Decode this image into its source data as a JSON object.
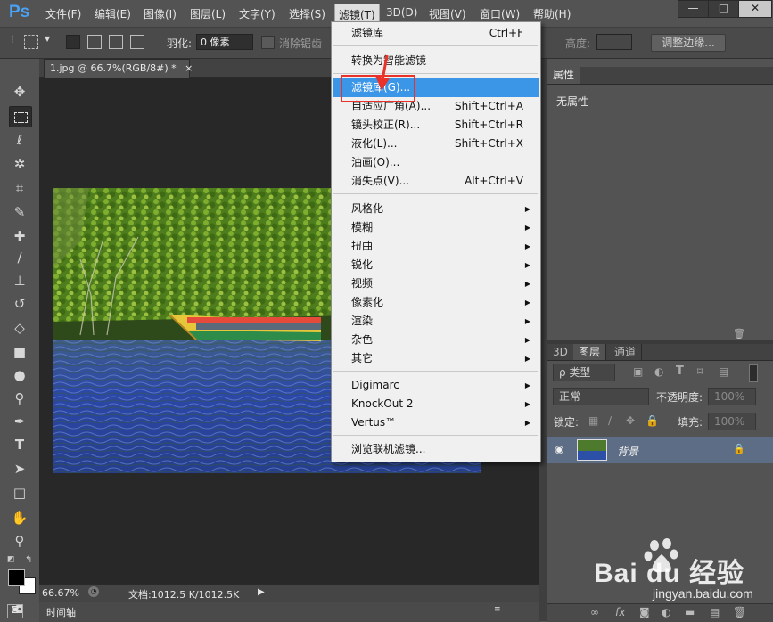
{
  "app": {
    "logo": "Ps",
    "menus": [
      "文件(F)",
      "编辑(E)",
      "图像(I)",
      "图层(L)",
      "文字(Y)",
      "选择(S)",
      "滤镜(T)",
      "3D(D)",
      "视图(V)",
      "窗口(W)",
      "帮助(H)"
    ],
    "active_menu": "滤镜(T)",
    "window_buttons": [
      "—",
      "□",
      "✕"
    ]
  },
  "options_bar": {
    "feather_label": "羽化:",
    "feather_value": "0 像素",
    "antialias_label": "消除锯齿",
    "height_label": "高度:",
    "refine_edge_button": "调整边缘..."
  },
  "document": {
    "tab_title": "1.jpg @ 66.7%(RGB/8#) *",
    "tab_close": "×",
    "zoom": "66.67%",
    "doc_info": "文档:1012.5 K/1012.5K",
    "timeline_label": "时间轴"
  },
  "properties_panel": {
    "tab": "属性",
    "content": "无属性"
  },
  "layers_panel": {
    "tabs": [
      "3D",
      "图层",
      "通道"
    ],
    "active_tab": "图层",
    "filter_label": "ρ 类型",
    "blend_mode": "正常",
    "opacity_label": "不透明度:",
    "opacity_value": "100%",
    "lock_label": "锁定:",
    "fill_label": "填充:",
    "fill_value": "100%",
    "layer_name": "背景"
  },
  "filter_menu": {
    "items": [
      {
        "label": "滤镜库",
        "shortcut": "Ctrl+F"
      },
      {
        "label": "转换为智能滤镜",
        "shortcut": ""
      },
      {
        "label": "滤镜库(G)...",
        "shortcut": "",
        "highlighted": true
      },
      {
        "label": "自适应广角(A)...",
        "shortcut": "Shift+Ctrl+A"
      },
      {
        "label": "镜头校正(R)...",
        "shortcut": "Shift+Ctrl+R"
      },
      {
        "label": "液化(L)...",
        "shortcut": "Shift+Ctrl+X"
      },
      {
        "label": "油画(O)...",
        "shortcut": ""
      },
      {
        "label": "消失点(V)...",
        "shortcut": "Alt+Ctrl+V"
      },
      {
        "label": "风格化",
        "submenu": true
      },
      {
        "label": "模糊",
        "submenu": true
      },
      {
        "label": "扭曲",
        "submenu": true
      },
      {
        "label": "锐化",
        "submenu": true
      },
      {
        "label": "视频",
        "submenu": true
      },
      {
        "label": "像素化",
        "submenu": true
      },
      {
        "label": "渲染",
        "submenu": true
      },
      {
        "label": "杂色",
        "submenu": true
      },
      {
        "label": "其它",
        "submenu": true
      },
      {
        "label": "Digimarc",
        "submenu": true
      },
      {
        "label": "KnockOut 2",
        "submenu": true
      },
      {
        "label": "Vertus™",
        "submenu": true
      },
      {
        "label": "浏览联机滤镜...",
        "shortcut": ""
      }
    ]
  },
  "watermark": {
    "brand": "Bai du 经验",
    "url": "jingyan.baidu.com"
  },
  "colors": {
    "highlight": "#3c96e8",
    "annotation_red": "#e8322a"
  }
}
